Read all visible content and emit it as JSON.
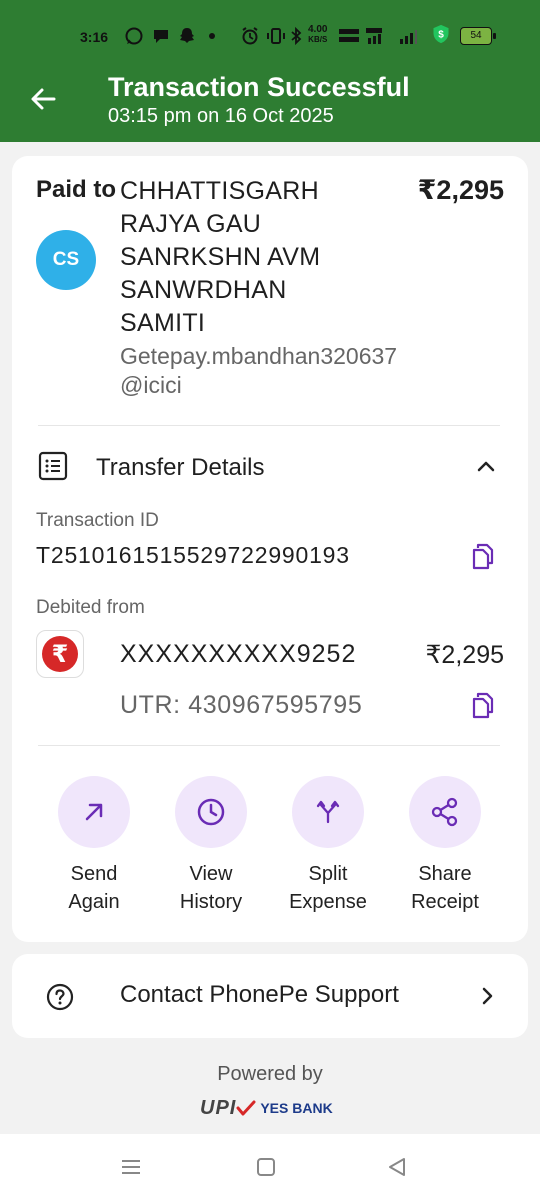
{
  "status_bar": {
    "time": "3:16",
    "speed_value": "4.00",
    "speed_unit": "KB/S",
    "battery": "54"
  },
  "header": {
    "title": "Transaction Successful",
    "subtitle": "03:15 pm on 16 Oct 2025"
  },
  "payment": {
    "paid_to_label": "Paid to",
    "amount": "₹2,295",
    "avatar_initials": "CS",
    "payee_name": "CHHATTISGARH RAJYA GAU SANRKSHN AVM SANWRDHAN SAMITI",
    "payee_vpa": "Getepay.mbandhan320637@icici"
  },
  "transfer_details": {
    "label": "Transfer Details",
    "transaction_id_label": "Transaction ID",
    "transaction_id": "T2510161515529722990193",
    "debited_from_label": "Debited from",
    "account": "XXXXXXXXXX9252",
    "debited_amount": "₹2,295",
    "utr": "UTR: 430967595795"
  },
  "actions": [
    {
      "line1": "Send",
      "line2": "Again",
      "icon": "arrow-up-right-icon"
    },
    {
      "line1": "View",
      "line2": "History",
      "icon": "clock-icon"
    },
    {
      "line1": "Split",
      "line2": "Expense",
      "icon": "split-icon"
    },
    {
      "line1": "Share",
      "line2": "Receipt",
      "icon": "share-icon"
    }
  ],
  "support": {
    "label": "Contact PhonePe Support"
  },
  "footer": {
    "powered_by": "Powered by",
    "upi_logo": "UPI",
    "bank_logo": "YES BANK"
  },
  "colors": {
    "header_green": "#2e7d32",
    "accent_purple": "#6a2cb5",
    "action_bg": "#f0e6fb",
    "avatar_blue": "#2fb0e8",
    "bank_red": "#d62828"
  }
}
